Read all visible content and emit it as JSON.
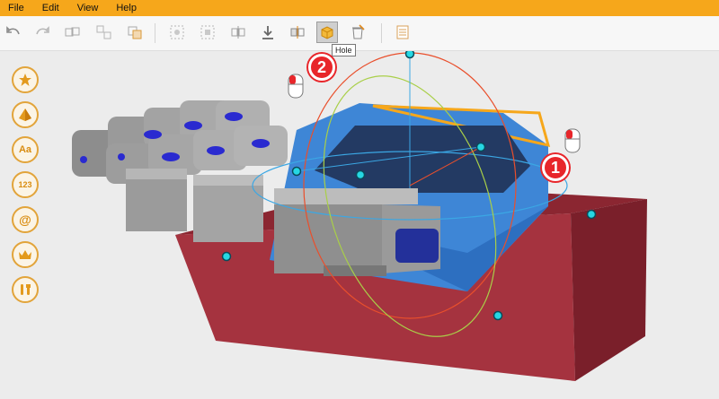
{
  "menu": {
    "items": [
      {
        "label": "File"
      },
      {
        "label": "Edit"
      },
      {
        "label": "View"
      },
      {
        "label": "Help"
      }
    ]
  },
  "toolbar": {
    "buttons": [
      {
        "icon": "undo-icon"
      },
      {
        "icon": "redo-icon"
      },
      {
        "icon": "group-icon"
      },
      {
        "icon": "ungroup-icon"
      },
      {
        "icon": "duplicate-icon"
      },
      {
        "icon": "align-icon"
      },
      {
        "icon": "distribute-icon"
      },
      {
        "icon": "mirror-icon"
      },
      {
        "icon": "drop-to-floor-icon"
      },
      {
        "icon": "flip-icon"
      },
      {
        "icon": "hole-icon"
      },
      {
        "icon": "delete-icon"
      },
      {
        "icon": "notes-icon"
      }
    ],
    "tooltip": "Hole"
  },
  "palette": {
    "items": [
      {
        "icon": "star-icon"
      },
      {
        "icon": "shapes-icon"
      },
      {
        "label": "Aa"
      },
      {
        "label": "123"
      },
      {
        "label": "@"
      },
      {
        "icon": "crown-icon"
      },
      {
        "icon": "tools-icon"
      }
    ]
  },
  "callouts": {
    "one": "1",
    "two": "2"
  },
  "colors": {
    "accent": "#f6a71b",
    "selected_part": "#3e86d6",
    "base": "#a5333f",
    "callout": "#e8262a"
  }
}
